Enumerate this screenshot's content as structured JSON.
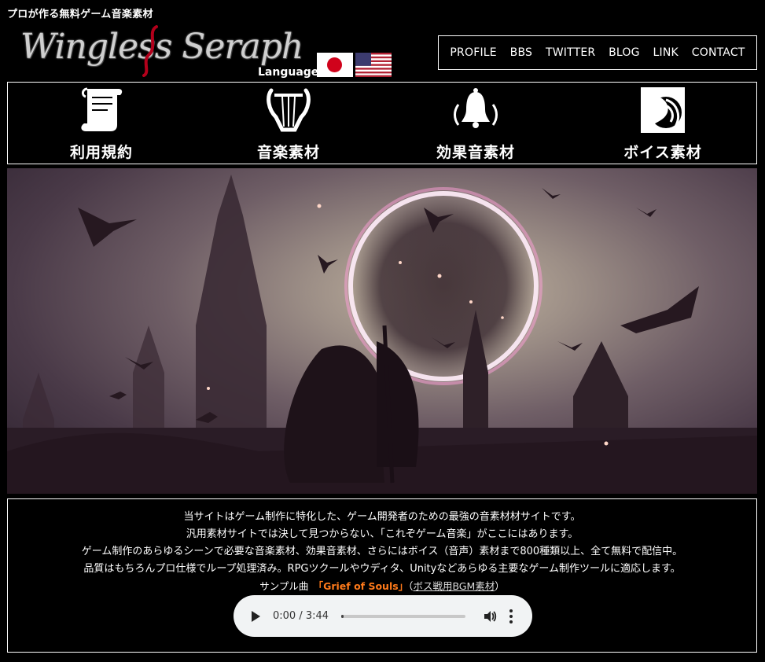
{
  "header": {
    "tagline": "プロが作る無料ゲーム音楽素材",
    "logo_text": "Wingless Seraph",
    "language_label": "Language:"
  },
  "languages": [
    {
      "name": "Japanese",
      "icon": "japan-flag-icon"
    },
    {
      "name": "English",
      "icon": "us-flag-icon"
    }
  ],
  "nav": {
    "items": [
      "PROFILE",
      "BBS",
      "TWITTER",
      "BLOG",
      "LINK",
      "CONTACT"
    ]
  },
  "menu": {
    "items": [
      {
        "label": "利用規約",
        "icon": "scroll-icon"
      },
      {
        "label": "音楽素材",
        "icon": "lyre-icon"
      },
      {
        "label": "効果音素材",
        "icon": "bell-icon"
      },
      {
        "label": "ボイス素材",
        "icon": "voice-icon"
      }
    ]
  },
  "info": {
    "lines": [
      "当サイトはゲーム制作に特化した、ゲーム開発者のための最強の音素材材サイトです。",
      "汎用素材サイトでは決して見つからない、「これぞゲーム音楽」がここにはあります。",
      "ゲーム制作のあらゆるシーンで必要な音楽素材、効果音素材、さらにはボイス（音声）素材まで800種類以上、全て無料で配信中。",
      "品質はもちろんプロ仕様でループ処理済み。RPGツクールやウディタ、Unityなどあらゆる主要なゲーム制作ツールに適応します。"
    ],
    "sample_prefix": "サンプル曲　",
    "sample_title": "「Grief of Souls」",
    "sample_paren_open": "（",
    "sample_link": "ボス戦用BGM素材",
    "sample_paren_close": "）"
  },
  "player": {
    "time": "0:00 / 3:44",
    "progress": 0.01
  },
  "colors": {
    "background": "#000000",
    "accent_orange": "#ff7a1a",
    "border": "#ffffff"
  }
}
